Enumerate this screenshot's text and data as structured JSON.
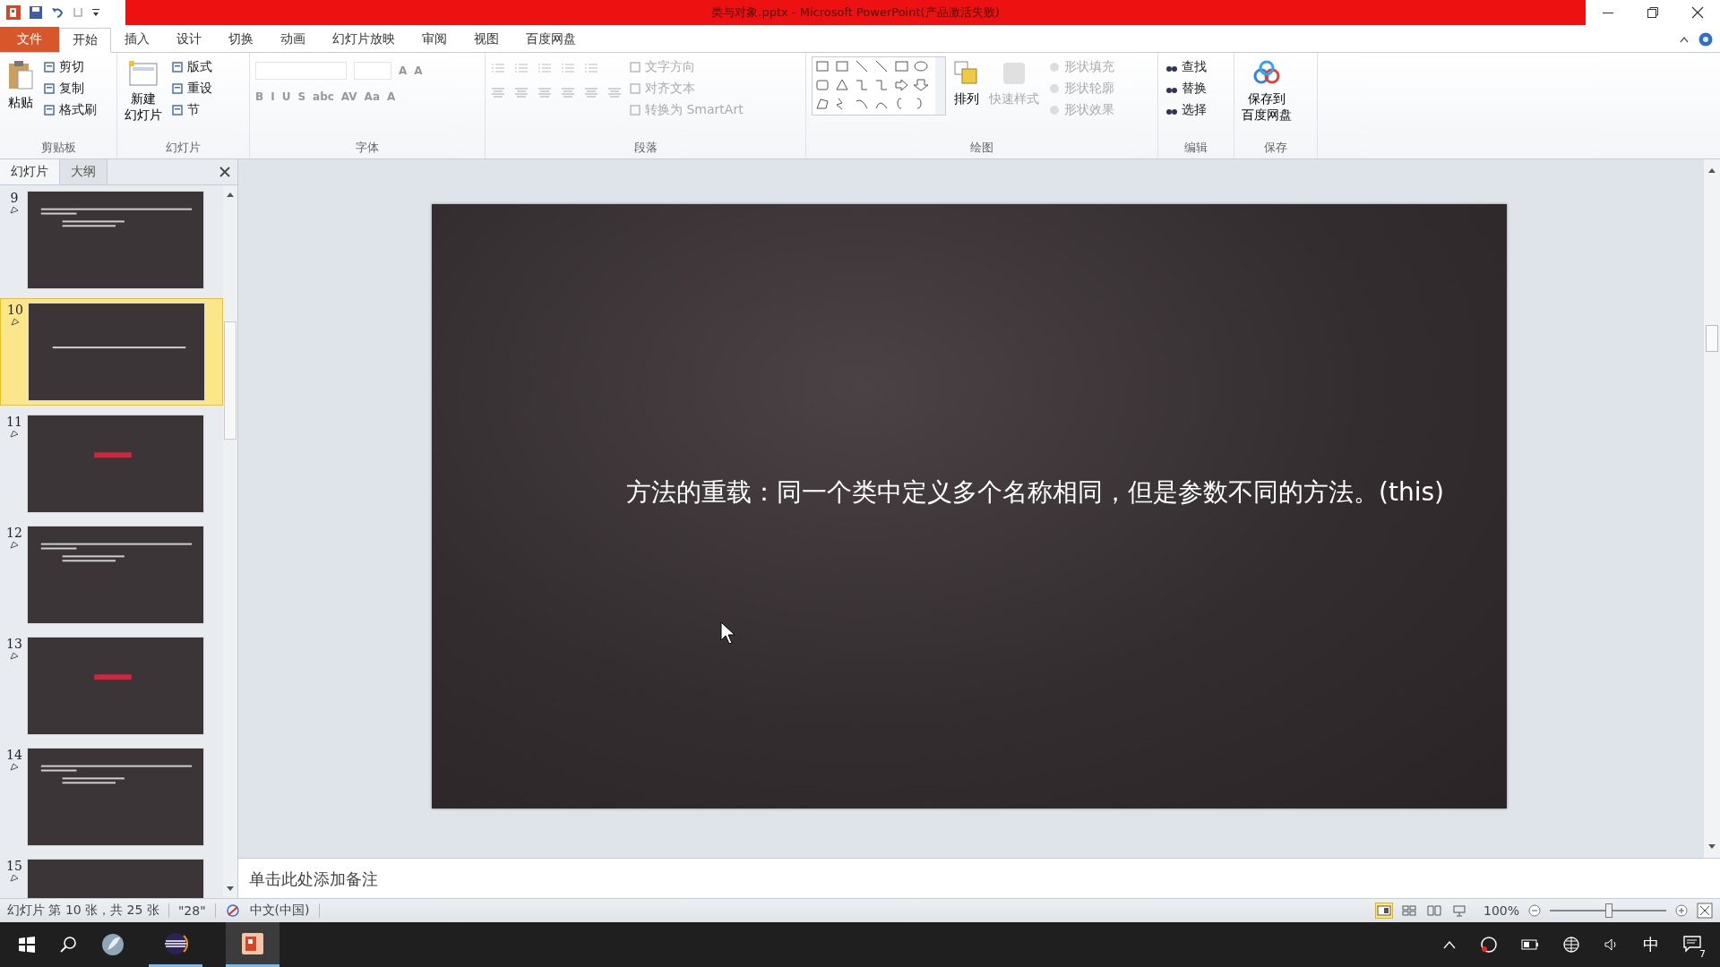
{
  "window": {
    "title": "类与对象.pptx - Microsoft PowerPoint(产品激活失败)"
  },
  "ribbon_tabs": [
    {
      "label": "文件",
      "kind": "file",
      "selected": false
    },
    {
      "label": "开始",
      "kind": "tab",
      "selected": true
    },
    {
      "label": "插入",
      "kind": "tab",
      "selected": false
    },
    {
      "label": "设计",
      "kind": "tab",
      "selected": false
    },
    {
      "label": "切换",
      "kind": "tab",
      "selected": false
    },
    {
      "label": "动画",
      "kind": "tab",
      "selected": false
    },
    {
      "label": "幻灯片放映",
      "kind": "tab",
      "selected": false
    },
    {
      "label": "审阅",
      "kind": "tab",
      "selected": false
    },
    {
      "label": "视图",
      "kind": "tab",
      "selected": false
    },
    {
      "label": "百度网盘",
      "kind": "tab",
      "selected": false
    }
  ],
  "ribbon_groups": [
    {
      "kind": "clipboard",
      "label": "剪贴板",
      "large": [
        "粘贴"
      ],
      "small": [
        {
          "label": "剪切",
          "disabled": false
        },
        {
          "label": "复制",
          "disabled": false
        },
        {
          "label": "格式刷",
          "disabled": false
        }
      ]
    },
    {
      "kind": "slides",
      "label": "幻灯片",
      "large": [
        "新建",
        "幻灯片"
      ],
      "small": [
        {
          "label": "版式",
          "disabled": false
        },
        {
          "label": "重设",
          "disabled": false
        },
        {
          "label": "节",
          "disabled": false
        }
      ]
    },
    {
      "kind": "font",
      "label": "字体",
      "glyphs": [
        "A",
        "A",
        "B",
        "I",
        "U",
        "S",
        "abc",
        "AV",
        "Aa",
        "A"
      ]
    },
    {
      "kind": "paragraph",
      "label": "段落",
      "small": [
        {
          "label": "文字方向",
          "disabled": true
        },
        {
          "label": "对齐文本",
          "disabled": true
        },
        {
          "label": "转换为 SmartArt",
          "disabled": true
        }
      ]
    },
    {
      "kind": "drawing",
      "label": "绘图",
      "large": [
        "排列"
      ],
      "large2": "快速样式",
      "small": [
        {
          "label": "形状填充",
          "disabled": true
        },
        {
          "label": "形状轮廓",
          "disabled": true
        },
        {
          "label": "形状效果",
          "disabled": true
        }
      ]
    },
    {
      "kind": "editing",
      "label": "编辑",
      "small": [
        {
          "label": "查找",
          "disabled": false
        },
        {
          "label": "替换",
          "disabled": false
        },
        {
          "label": "选择",
          "disabled": false
        }
      ]
    },
    {
      "kind": "save",
      "label": "保存",
      "large": [
        "保存到",
        "百度网盘"
      ]
    }
  ],
  "panel_tabs": [
    {
      "label": "幻灯片",
      "selected": true
    },
    {
      "label": "大纲",
      "selected": false
    }
  ],
  "thumbnails": [
    {
      "number": "9",
      "kind": "text",
      "selected": false
    },
    {
      "number": "10",
      "kind": "line",
      "selected": true
    },
    {
      "number": "11",
      "kind": "heading",
      "selected": false
    },
    {
      "number": "12",
      "kind": "text",
      "selected": false
    },
    {
      "number": "13",
      "kind": "heading",
      "selected": false
    },
    {
      "number": "14",
      "kind": "text",
      "selected": false
    },
    {
      "number": "15",
      "kind": "blank",
      "selected": false
    }
  ],
  "slide": {
    "text": "方法的重载：同一个类中定义多个名称相同，但是参数不同的方法。(this)"
  },
  "notes": {
    "placeholder": "单击此处添加备注"
  },
  "status_bar": {
    "slide_info": "幻灯片 第 10 张，共 25 张",
    "theme": "\"28\"",
    "language": "中文(中国)",
    "zoom": "100%",
    "zoom_slider": {
      "level": 0.5
    }
  },
  "taskbar": {
    "ime": "中",
    "notifications": "7"
  }
}
